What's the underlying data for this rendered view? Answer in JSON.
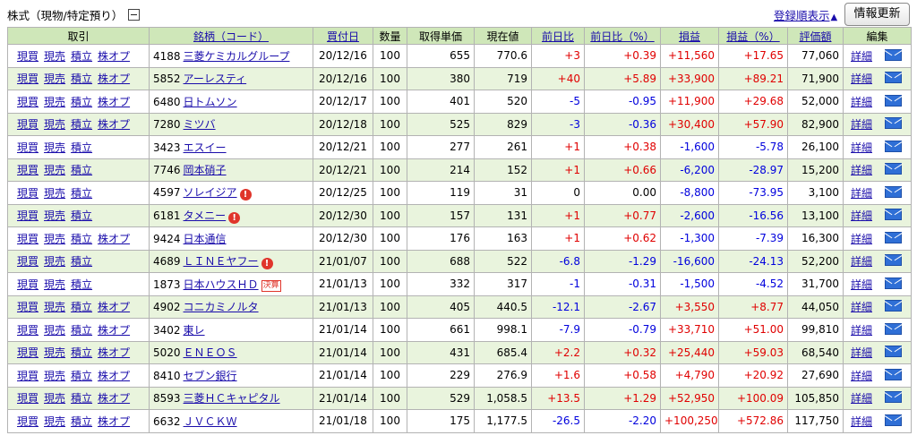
{
  "header": {
    "section_title": "株式（現物/特定預り）",
    "register_order_link": "登録順表示",
    "refresh_button": "情報更新"
  },
  "columns": [
    "取引",
    "銘柄（コード）",
    "買付日",
    "数量",
    "取得単価",
    "現在値",
    "前日比",
    "前日比（%）",
    "損益",
    "損益（%）",
    "評価額",
    "編集"
  ],
  "trade_labels": {
    "spot_buy": "現買",
    "spot_sell": "現売",
    "accumulate": "積立",
    "stock_option": "株オプ"
  },
  "edit_labels": {
    "detail": "詳細"
  },
  "colors": {
    "header_bg": "#cfe7b9",
    "row_green": "#e9f4dd",
    "positive": "#e00000",
    "negative": "#0000dd",
    "link": "#1a0dab"
  },
  "rows": [
    {
      "code": "4188",
      "name": "三菱ケミカルグループ",
      "date": "20/12/16",
      "qty": "100",
      "cost": "655",
      "price": "770.6",
      "chg": "+3",
      "chg_pct": "+0.39",
      "pl": "+11,560",
      "pl_pct": "+17.65",
      "value": "77,060",
      "has_option": true,
      "alert": false,
      "kessan": ""
    },
    {
      "code": "5852",
      "name": "アーレスティ",
      "date": "20/12/16",
      "qty": "100",
      "cost": "380",
      "price": "719",
      "chg": "+40",
      "chg_pct": "+5.89",
      "pl": "+33,900",
      "pl_pct": "+89.21",
      "value": "71,900",
      "has_option": true,
      "alert": false,
      "kessan": ""
    },
    {
      "code": "6480",
      "name": "日トムソン",
      "date": "20/12/17",
      "qty": "100",
      "cost": "401",
      "price": "520",
      "chg": "-5",
      "chg_pct": "-0.95",
      "pl": "+11,900",
      "pl_pct": "+29.68",
      "value": "52,000",
      "has_option": true,
      "alert": false,
      "kessan": ""
    },
    {
      "code": "7280",
      "name": "ミツバ",
      "date": "20/12/18",
      "qty": "100",
      "cost": "525",
      "price": "829",
      "chg": "-3",
      "chg_pct": "-0.36",
      "pl": "+30,400",
      "pl_pct": "+57.90",
      "value": "82,900",
      "has_option": true,
      "alert": false,
      "kessan": ""
    },
    {
      "code": "3423",
      "name": "エスイー",
      "date": "20/12/21",
      "qty": "100",
      "cost": "277",
      "price": "261",
      "chg": "+1",
      "chg_pct": "+0.38",
      "pl": "-1,600",
      "pl_pct": "-5.78",
      "value": "26,100",
      "has_option": false,
      "alert": false,
      "kessan": ""
    },
    {
      "code": "7746",
      "name": "岡本硝子",
      "date": "20/12/21",
      "qty": "100",
      "cost": "214",
      "price": "152",
      "chg": "+1",
      "chg_pct": "+0.66",
      "pl": "-6,200",
      "pl_pct": "-28.97",
      "value": "15,200",
      "has_option": false,
      "alert": false,
      "kessan": ""
    },
    {
      "code": "4597",
      "name": "ソレイジア",
      "date": "20/12/25",
      "qty": "100",
      "cost": "119",
      "price": "31",
      "chg": "0",
      "chg_pct": "0.00",
      "pl": "-8,800",
      "pl_pct": "-73.95",
      "value": "3,100",
      "has_option": false,
      "alert": true,
      "kessan": ""
    },
    {
      "code": "6181",
      "name": "タメニー",
      "date": "20/12/30",
      "qty": "100",
      "cost": "157",
      "price": "131",
      "chg": "+1",
      "chg_pct": "+0.77",
      "pl": "-2,600",
      "pl_pct": "-16.56",
      "value": "13,100",
      "has_option": false,
      "alert": true,
      "kessan": ""
    },
    {
      "code": "9424",
      "name": "日本通信",
      "date": "20/12/30",
      "qty": "100",
      "cost": "176",
      "price": "163",
      "chg": "+1",
      "chg_pct": "+0.62",
      "pl": "-1,300",
      "pl_pct": "-7.39",
      "value": "16,300",
      "has_option": true,
      "alert": false,
      "kessan": ""
    },
    {
      "code": "4689",
      "name": "ＬＩＮＥヤフー",
      "date": "21/01/07",
      "qty": "100",
      "cost": "688",
      "price": "522",
      "chg": "-6.8",
      "chg_pct": "-1.29",
      "pl": "-16,600",
      "pl_pct": "-24.13",
      "value": "52,200",
      "has_option": false,
      "alert": true,
      "kessan": ""
    },
    {
      "code": "1873",
      "name": "日本ハウスＨＤ",
      "date": "21/01/13",
      "qty": "100",
      "cost": "332",
      "price": "317",
      "chg": "-1",
      "chg_pct": "-0.31",
      "pl": "-1,500",
      "pl_pct": "-4.52",
      "value": "31,700",
      "has_option": false,
      "alert": false,
      "kessan": "決算"
    },
    {
      "code": "4902",
      "name": "コニカミノルタ",
      "date": "21/01/13",
      "qty": "100",
      "cost": "405",
      "price": "440.5",
      "chg": "-12.1",
      "chg_pct": "-2.67",
      "pl": "+3,550",
      "pl_pct": "+8.77",
      "value": "44,050",
      "has_option": true,
      "alert": false,
      "kessan": ""
    },
    {
      "code": "3402",
      "name": "東レ",
      "date": "21/01/14",
      "qty": "100",
      "cost": "661",
      "price": "998.1",
      "chg": "-7.9",
      "chg_pct": "-0.79",
      "pl": "+33,710",
      "pl_pct": "+51.00",
      "value": "99,810",
      "has_option": true,
      "alert": false,
      "kessan": ""
    },
    {
      "code": "5020",
      "name": "ＥＮＥＯＳ",
      "date": "21/01/14",
      "qty": "100",
      "cost": "431",
      "price": "685.4",
      "chg": "+2.2",
      "chg_pct": "+0.32",
      "pl": "+25,440",
      "pl_pct": "+59.03",
      "value": "68,540",
      "has_option": true,
      "alert": false,
      "kessan": ""
    },
    {
      "code": "8410",
      "name": "セブン銀行",
      "date": "21/01/14",
      "qty": "100",
      "cost": "229",
      "price": "276.9",
      "chg": "+1.6",
      "chg_pct": "+0.58",
      "pl": "+4,790",
      "pl_pct": "+20.92",
      "value": "27,690",
      "has_option": true,
      "alert": false,
      "kessan": ""
    },
    {
      "code": "8593",
      "name": "三菱ＨＣキャピタル",
      "date": "21/01/14",
      "qty": "100",
      "cost": "529",
      "price": "1,058.5",
      "chg": "+13.5",
      "chg_pct": "+1.29",
      "pl": "+52,950",
      "pl_pct": "+100.09",
      "value": "105,850",
      "has_option": true,
      "alert": false,
      "kessan": ""
    },
    {
      "code": "6632",
      "name": "ＪＶＣＫＷ",
      "date": "21/01/18",
      "qty": "100",
      "cost": "175",
      "price": "1,177.5",
      "chg": "-26.5",
      "chg_pct": "-2.20",
      "pl": "+100,250",
      "pl_pct": "+572.86",
      "value": "117,750",
      "has_option": true,
      "alert": false,
      "kessan": ""
    }
  ]
}
